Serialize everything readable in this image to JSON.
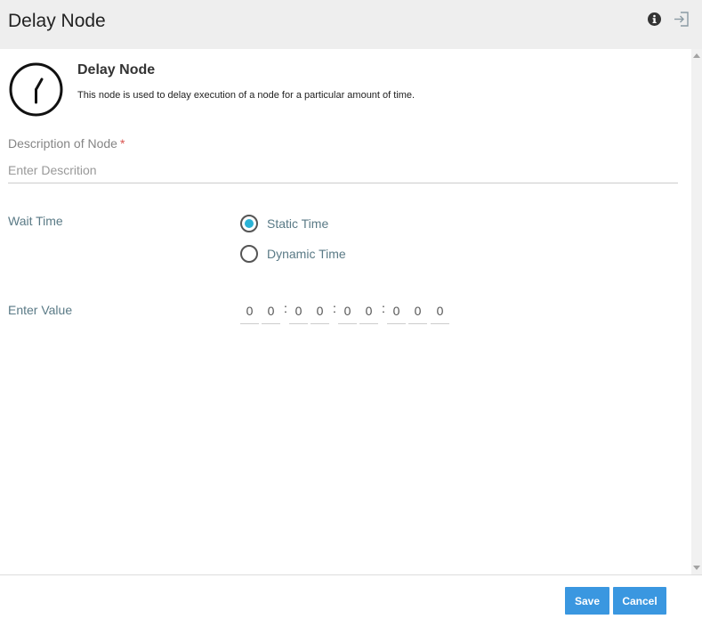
{
  "header": {
    "title": "Delay Node",
    "info_icon": "info-circle-icon",
    "exit_icon": "sign-in-icon"
  },
  "node": {
    "icon": "clock-icon",
    "title": "Delay Node",
    "description": "This node is used to delay execution of a node for a particular amount of time."
  },
  "description_field": {
    "label": "Description of Node",
    "required_mark": "*",
    "placeholder": "Enter Descrition",
    "value": ""
  },
  "wait_time": {
    "label": "Wait Time",
    "options": [
      {
        "label": "Static Time",
        "selected": true
      },
      {
        "label": "Dynamic Time",
        "selected": false
      }
    ]
  },
  "enter_value": {
    "label": "Enter Value",
    "digits": [
      "0",
      "0",
      "0",
      "0",
      "0",
      "0",
      "0",
      "0",
      "0"
    ],
    "separator": ":"
  },
  "footer": {
    "save_label": "Save",
    "cancel_label": "Cancel"
  },
  "colors": {
    "accent": "#3a97e0",
    "radio_selected": "#2bb3d6",
    "required": "#d9534f"
  }
}
